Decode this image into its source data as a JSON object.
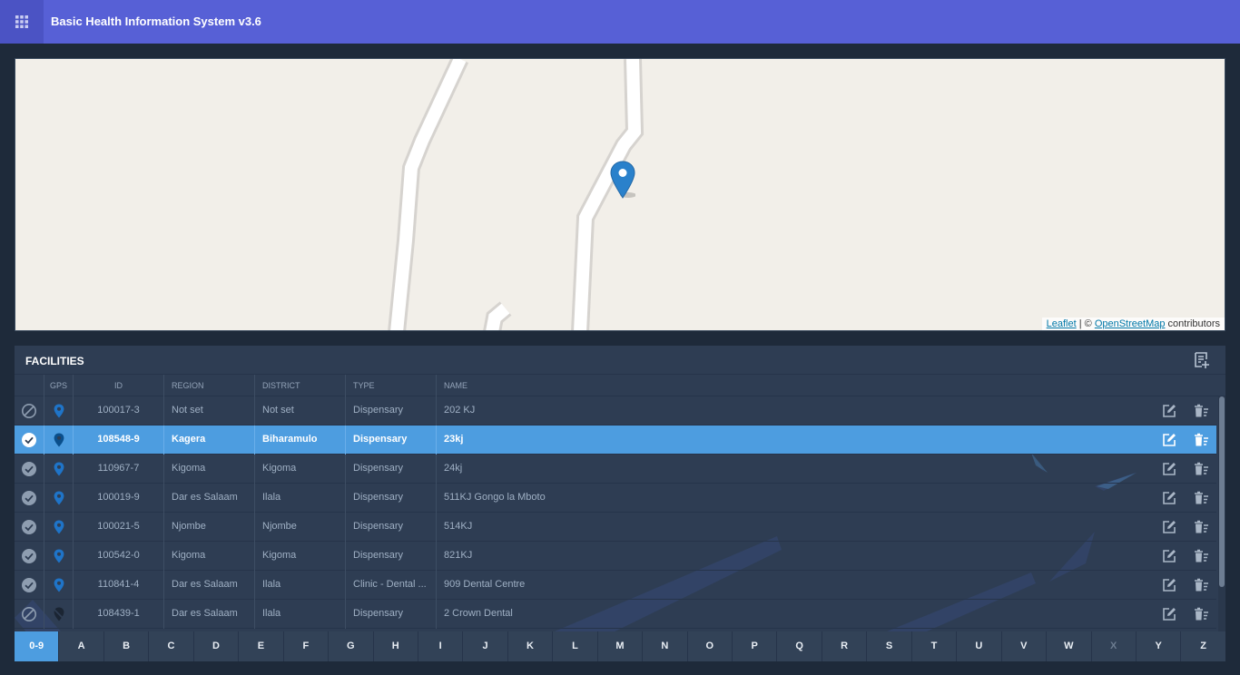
{
  "app": {
    "title": "Basic Health Information System v3.6"
  },
  "map": {
    "attribution": {
      "leaflet": "Leaflet",
      "separator": " | © ",
      "osm": "OpenStreetMap",
      "suffix": " contributors"
    }
  },
  "facilities": {
    "title": "FACILITIES",
    "columns": {
      "gps": "GPS",
      "id": "ID",
      "region": "REGION",
      "district": "DISTRICT",
      "type": "TYPE",
      "name": "NAME"
    },
    "rows": [
      {
        "status": "disabled",
        "gps": "set",
        "id": "100017-3",
        "region": "Not set",
        "district": "Not set",
        "type": "Dispensary",
        "name": "202 KJ",
        "selected": false
      },
      {
        "status": "active",
        "gps": "set",
        "id": "108548-9",
        "region": "Kagera",
        "district": "Biharamulo",
        "type": "Dispensary",
        "name": "23kj",
        "selected": true
      },
      {
        "status": "active",
        "gps": "set",
        "id": "110967-7",
        "region": "Kigoma",
        "district": "Kigoma",
        "type": "Dispensary",
        "name": "24kj",
        "selected": false
      },
      {
        "status": "active",
        "gps": "set",
        "id": "100019-9",
        "region": "Dar es Salaam",
        "district": "Ilala",
        "type": "Dispensary",
        "name": "511KJ Gongo la Mboto",
        "selected": false
      },
      {
        "status": "active",
        "gps": "set",
        "id": "100021-5",
        "region": "Njombe",
        "district": "Njombe",
        "type": "Dispensary",
        "name": "514KJ",
        "selected": false
      },
      {
        "status": "active",
        "gps": "set",
        "id": "100542-0",
        "region": "Kigoma",
        "district": "Kigoma",
        "type": "Dispensary",
        "name": "821KJ",
        "selected": false
      },
      {
        "status": "active",
        "gps": "set",
        "id": "110841-4",
        "region": "Dar es Salaam",
        "district": "Ilala",
        "type": "Clinic - Dental ...",
        "name": "909 Dental Centre",
        "selected": false
      },
      {
        "status": "disabled",
        "gps": "off",
        "id": "108439-1",
        "region": "Dar es Salaam",
        "district": "Ilala",
        "type": "Dispensary",
        "name": "2 Crown Dental",
        "selected": false
      }
    ],
    "alphabet": [
      "0-9",
      "A",
      "B",
      "C",
      "D",
      "E",
      "F",
      "G",
      "H",
      "I",
      "J",
      "K",
      "L",
      "M",
      "N",
      "O",
      "P",
      "Q",
      "R",
      "S",
      "T",
      "U",
      "V",
      "W",
      "X",
      "Y",
      "Z"
    ],
    "alphabet_active": "0-9",
    "alphabet_disabled": [
      "X"
    ]
  },
  "colors": {
    "header": "#5760d6",
    "accent": "#4d9de0",
    "panel": "#2e3d53",
    "background": "#1e2a3a",
    "gps_pin": "#1f74c8"
  },
  "icons": {
    "menu": "apps-grid-icon",
    "add": "add-list-icon",
    "disabled": "block-icon",
    "active": "check-circle-icon",
    "gps": "location-pin-icon",
    "gps_off": "location-off-icon",
    "edit": "edit-icon",
    "delete": "delete-list-icon"
  }
}
